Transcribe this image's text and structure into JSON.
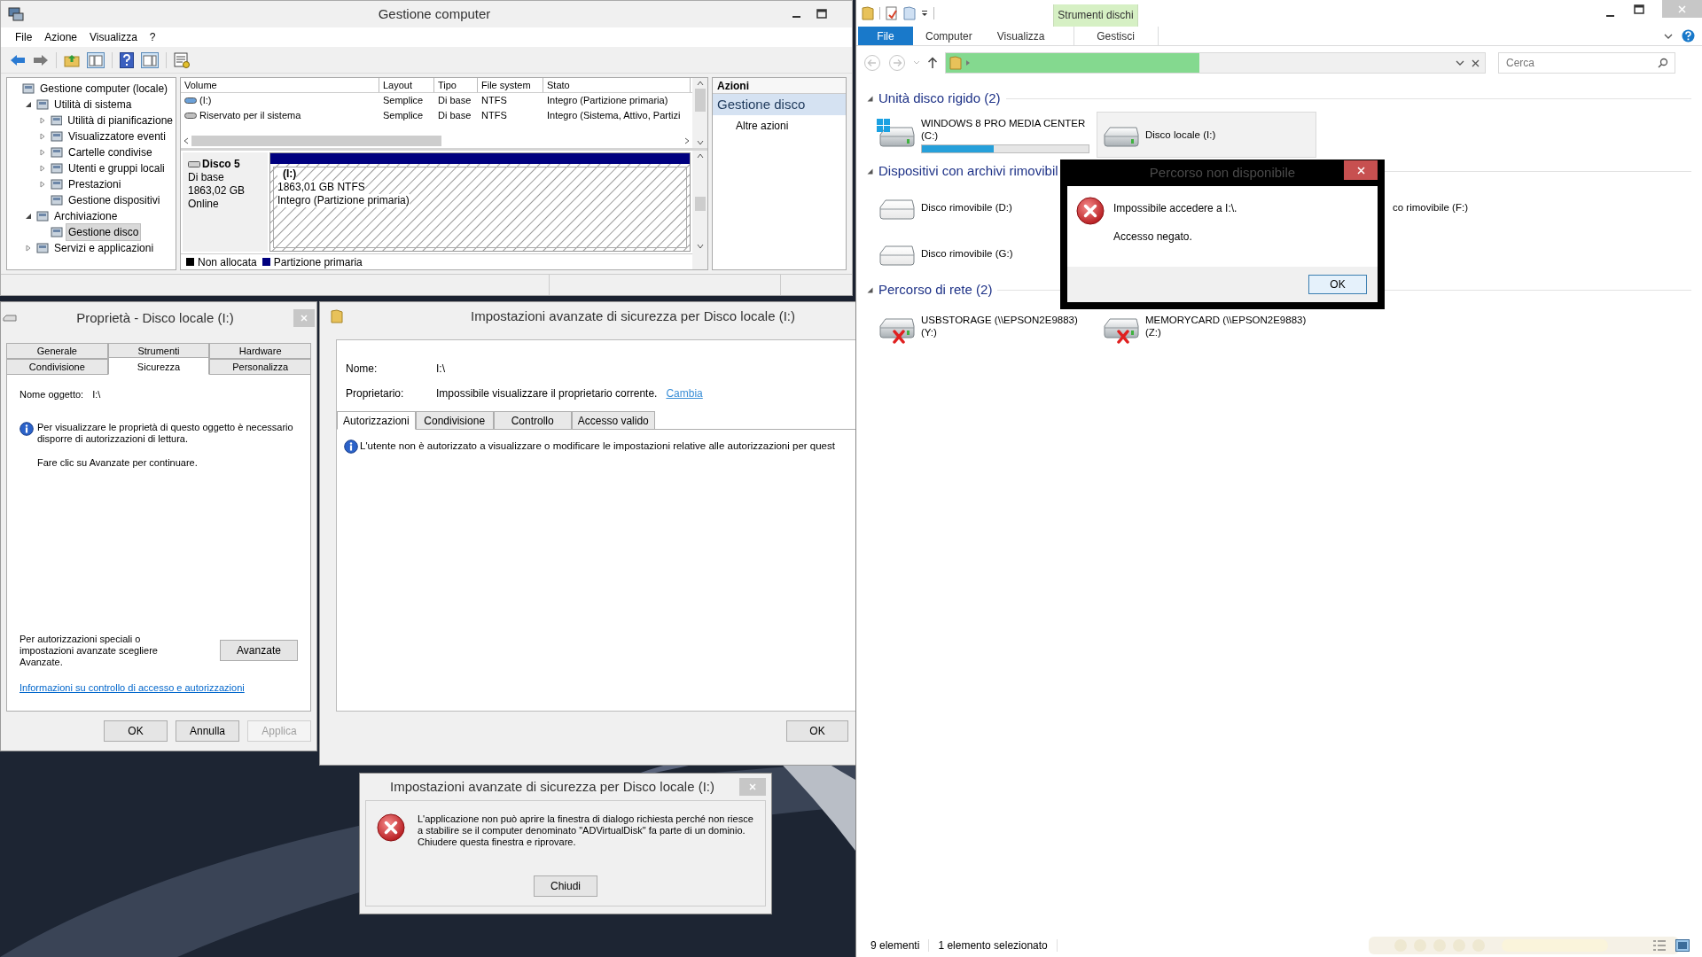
{
  "computer_management": {
    "title": "Gestione computer",
    "menu": [
      "File",
      "Azione",
      "Visualizza",
      "?"
    ],
    "tree": [
      {
        "label": "Gestione computer (locale)",
        "selected": false,
        "children": [
          {
            "label": "Utilità di sistema",
            "expanded": true,
            "selected": false,
            "children": [
              {
                "label": "Utilità di pianificazione",
                "expanded": false,
                "selected": false
              },
              {
                "label": "Visualizzatore eventi",
                "expanded": false,
                "selected": false
              },
              {
                "label": "Cartelle condivise",
                "expanded": false,
                "selected": false
              },
              {
                "label": "Utenti e gruppi locali",
                "expanded": false,
                "selected": false
              },
              {
                "label": "Prestazioni",
                "expanded": false,
                "selected": false
              },
              {
                "label": "Gestione dispositivi",
                "selected": false
              }
            ]
          },
          {
            "label": "Archiviazione",
            "expanded": true,
            "selected": false,
            "children": [
              {
                "label": "Gestione disco",
                "selected": true
              }
            ]
          },
          {
            "label": "Servizi e applicazioni",
            "expanded": false,
            "selected": false
          }
        ]
      }
    ],
    "volumes": {
      "columns": [
        "Volume",
        "Layout",
        "Tipo",
        "File system",
        "Stato"
      ],
      "rows": [
        [
          "(I:)",
          "Semplice",
          "Di base",
          "NTFS",
          "Integro (Partizione primaria)"
        ],
        [
          "Riservato per il sistema",
          "Semplice",
          "Di base",
          "NTFS",
          "Integro (Sistema, Attivo, Partizi"
        ]
      ]
    },
    "disk": {
      "name": "Disco 5",
      "type": "Di base",
      "size": "1863,02 GB",
      "status": "Online",
      "partition": {
        "label": "(I:)",
        "size": "1863,01 GB NTFS",
        "status": "Integro (Partizione primaria)",
        "color": "#00007f"
      }
    },
    "legend": [
      {
        "label": "Non allocata",
        "color": "#000000"
      },
      {
        "label": "Partizione primaria",
        "color": "#00007f"
      }
    ],
    "actions": {
      "header": "Azioni",
      "section": "Gestione disco",
      "items": [
        "Altre azioni"
      ]
    }
  },
  "properties_dialog": {
    "title": "Proprietà - Disco locale (I:)",
    "tab_rows": [
      [
        {
          "label": "Generale",
          "selected": false
        },
        {
          "label": "Strumenti",
          "selected": false
        },
        {
          "label": "Hardware",
          "selected": false
        }
      ],
      [
        {
          "label": "Condivisione",
          "selected": false
        },
        {
          "label": "Sicurezza",
          "selected": true
        },
        {
          "label": "Personalizza",
          "selected": false
        }
      ]
    ],
    "object_label": "Nome oggetto:",
    "object_value": "I:\\",
    "info": "Per visualizzare le proprietà di questo oggetto è necessario disporre di autorizzazioni di lettura.",
    "hint": "Fare clic su Avanzate per continuare.",
    "advanced_note": "Per autorizzazioni speciali o impostazioni avanzate scegliere Avanzate.",
    "advanced_button": "Avanzate",
    "link": "Informazioni su controllo di accesso e autorizzazioni",
    "buttons": [
      {
        "label": "OK",
        "disabled": false
      },
      {
        "label": "Annulla",
        "disabled": false
      },
      {
        "label": "Applica",
        "disabled": true
      }
    ]
  },
  "advanced_security": {
    "title": "Impostazioni avanzate di sicurezza per Disco locale (I:)",
    "fields": [
      {
        "label": "Nome:",
        "value": "I:\\"
      },
      {
        "label": "Proprietario:",
        "value": "Impossibile visualizzare il proprietario corrente.",
        "link": "Cambia"
      }
    ],
    "tabs": [
      {
        "label": "Autorizzazioni",
        "selected": true
      },
      {
        "label": "Condivisione",
        "selected": false
      },
      {
        "label": "Controllo",
        "selected": false
      },
      {
        "label": "Accesso valido",
        "selected": false
      }
    ],
    "info": "L'utente non è autorizzato a visualizzare o modificare le impostazioni relative alle autorizzazioni per quest",
    "button": "OK"
  },
  "error_dialog": {
    "title": "Impostazioni avanzate di sicurezza per Disco locale (I:)",
    "message": "L'applicazione non può aprire la finestra di dialogo richiesta perché non riesce a stabilire se il computer denominato \"ADVirtualDisk\" fa parte di un dominio. Chiudere questa finestra e riprovare.",
    "button": "Chiudi"
  },
  "explorer": {
    "context_label": "Strumenti dischi",
    "tabs": [
      {
        "label": "File",
        "kind": "file"
      },
      {
        "label": "Computer",
        "kind": "tab"
      },
      {
        "label": "Visualizza",
        "kind": "tab"
      },
      {
        "label": "Gestisci",
        "kind": "context"
      }
    ],
    "address": {
      "level": 0.47
    },
    "search": {
      "placeholder": "Cerca"
    },
    "groups": [
      {
        "title": "Unità disco rigido (2)",
        "items": [
          {
            "name": "WINDOWS 8 PRO MEDIA CENTER (C:)",
            "kind": "system",
            "level": 0.43,
            "selected": false
          },
          {
            "name": "Disco locale (I:)",
            "kind": "hdd",
            "selected": true
          }
        ]
      },
      {
        "title": "Dispositivi con archivi rimovibil",
        "items": [
          {
            "name": "Disco rimovibile (D:)",
            "kind": "removable",
            "selected": false
          },
          {
            "name": "co rimovibile (F:)",
            "kind": "covered",
            "selected": false
          },
          {
            "name": "Disco rimovibile (G:)",
            "kind": "removable",
            "selected": false
          }
        ]
      },
      {
        "title": "Percorso di rete (2)",
        "items": [
          {
            "name": "USBSTORAGE (\\\\EPSON2E9883) (Y:)",
            "kind": "network",
            "selected": false
          },
          {
            "name": "MEMORYCARD (\\\\EPSON2E9883) (Z:)",
            "kind": "network",
            "selected": false
          }
        ]
      }
    ],
    "status": [
      "9 elementi",
      "1 elemento selezionato"
    ]
  },
  "path_dialog": {
    "title": "Percorso non disponibile",
    "message": "Impossibile accedere a I:\\.",
    "detail": "Accesso negato.",
    "button": "OK"
  }
}
